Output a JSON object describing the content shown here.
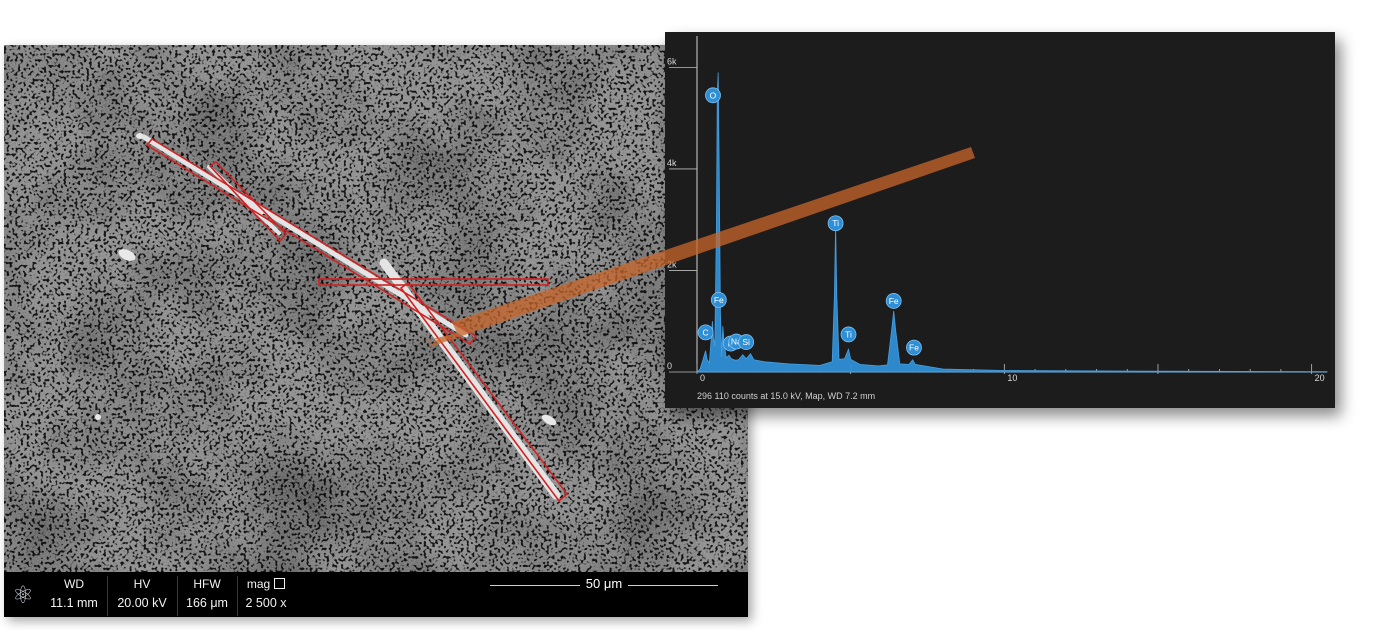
{
  "sem": {
    "databar": {
      "fields": [
        {
          "label": "WD",
          "value": "11.1 mm"
        },
        {
          "label": "HV",
          "value": "20.00 kV"
        },
        {
          "label": "HFW",
          "value": "166 μm"
        },
        {
          "label": "mag",
          "value": "2 500 x"
        }
      ],
      "scale_label": "50 μm"
    },
    "logo_icon": "atom-icon",
    "highlight_color": "#d32222"
  },
  "chart_data": {
    "type": "line",
    "title": "",
    "xlabel": "",
    "ylabel": "",
    "xlim": [
      0,
      20.5
    ],
    "ylim": [
      0,
      6500
    ],
    "x_ticks": [
      0,
      10,
      20
    ],
    "y_ticks": [
      {
        "value": 0,
        "label": "0"
      },
      {
        "value": 2000,
        "label": "2k"
      },
      {
        "value": 4000,
        "label": "4k"
      },
      {
        "value": 6000,
        "label": "6k"
      }
    ],
    "series": [
      {
        "color": "#2f8fd6",
        "points": [
          [
            0.0,
            0
          ],
          [
            0.1,
            60
          ],
          [
            0.2,
            250
          ],
          [
            0.28,
            420
          ],
          [
            0.33,
            250
          ],
          [
            0.4,
            180
          ],
          [
            0.47,
            700
          ],
          [
            0.5,
            1000
          ],
          [
            0.53,
            700
          ],
          [
            0.58,
            500
          ],
          [
            0.63,
            2800
          ],
          [
            0.66,
            5500
          ],
          [
            0.69,
            5900
          ],
          [
            0.72,
            4200
          ],
          [
            0.76,
            1200
          ],
          [
            0.8,
            300
          ],
          [
            0.84,
            900
          ],
          [
            0.88,
            600
          ],
          [
            0.95,
            280
          ],
          [
            1.04,
            330
          ],
          [
            1.12,
            260
          ],
          [
            1.25,
            230
          ],
          [
            1.35,
            240
          ],
          [
            1.49,
            340
          ],
          [
            1.6,
            260
          ],
          [
            1.74,
            360
          ],
          [
            1.85,
            240
          ],
          [
            2.2,
            200
          ],
          [
            3.0,
            160
          ],
          [
            4.0,
            130
          ],
          [
            4.4,
            200
          ],
          [
            4.47,
            1500
          ],
          [
            4.51,
            2900
          ],
          [
            4.55,
            1500
          ],
          [
            4.62,
            250
          ],
          [
            4.8,
            260
          ],
          [
            4.93,
            450
          ],
          [
            5.0,
            250
          ],
          [
            5.3,
            150
          ],
          [
            5.9,
            120
          ],
          [
            6.2,
            140
          ],
          [
            6.33,
            800
          ],
          [
            6.4,
            1200
          ],
          [
            6.47,
            800
          ],
          [
            6.6,
            160
          ],
          [
            6.9,
            150
          ],
          [
            7.02,
            240
          ],
          [
            7.1,
            150
          ],
          [
            8.0,
            60
          ],
          [
            10.0,
            30
          ],
          [
            15.0,
            15
          ],
          [
            20.5,
            5
          ]
        ]
      }
    ],
    "peaks": [
      {
        "label": "O",
        "x": 0.52,
        "y": 5450
      },
      {
        "label": "Ti",
        "x": 4.51,
        "y": 2930
      },
      {
        "label": "Fe",
        "x": 0.71,
        "y": 1420
      },
      {
        "label": "Fe",
        "x": 6.4,
        "y": 1400
      },
      {
        "label": "C",
        "x": 0.28,
        "y": 780
      },
      {
        "label": "N",
        "x": 1.1,
        "y": 560
      },
      {
        "label": "Na",
        "x": 1.28,
        "y": 600
      },
      {
        "label": "Si",
        "x": 1.6,
        "y": 590
      },
      {
        "label": "Ti",
        "x": 4.93,
        "y": 740
      },
      {
        "label": "Fe",
        "x": 7.06,
        "y": 480
      }
    ],
    "caption": "296 110 counts at 15.0 kV, Map, WD 7.2 mm"
  },
  "colors": {
    "panel_bg": "#1c1c1c",
    "spectrum": "#2f8fd6",
    "arrow": "#c8652a"
  }
}
